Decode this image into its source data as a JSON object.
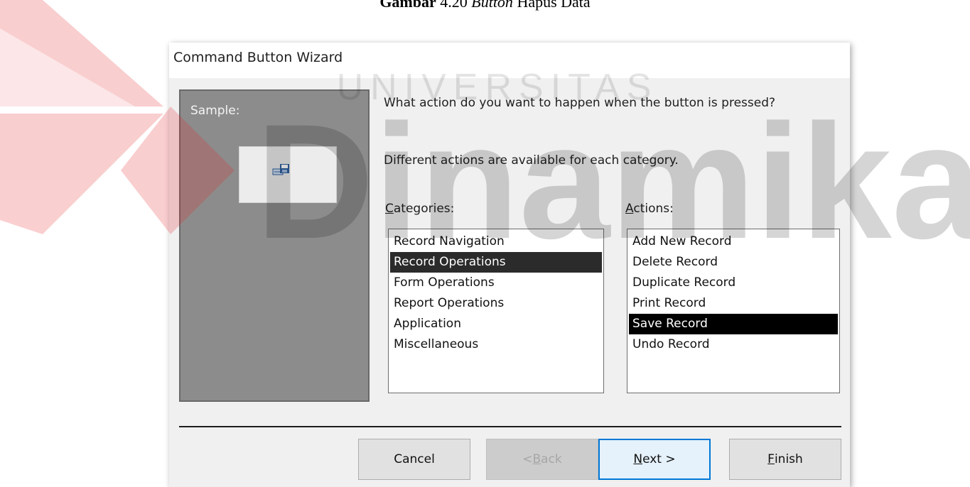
{
  "caption": {
    "prefix": "Gambar",
    "number": " 4.20 ",
    "italic": "Button",
    "suffix": " Hapus Data"
  },
  "watermark": {
    "upper": "UNIVERSITAS",
    "lower": "Dinamika",
    "color": "#e6232b"
  },
  "dialog": {
    "title": "Command Button Wizard",
    "sample_label": "Sample:",
    "sample_icon": "save-record-icon",
    "question": "What action do you want to happen when the button is pressed?",
    "hint": "Different actions are available for each category.",
    "categories_label": "Categories:",
    "actions_label": "Actions:",
    "categories": [
      "Record Navigation",
      "Record Operations",
      "Form Operations",
      "Report Operations",
      "Application",
      "Miscellaneous"
    ],
    "selected_category": "Record Operations",
    "actions": [
      "Add New Record",
      "Delete Record",
      "Duplicate Record",
      "Print Record",
      "Save Record",
      "Undo Record"
    ],
    "selected_action": "Save Record",
    "buttons": {
      "cancel": "Cancel",
      "back": "< Back",
      "next": "Next >",
      "finish": "Finish"
    },
    "focus_color": "#0078d7"
  }
}
